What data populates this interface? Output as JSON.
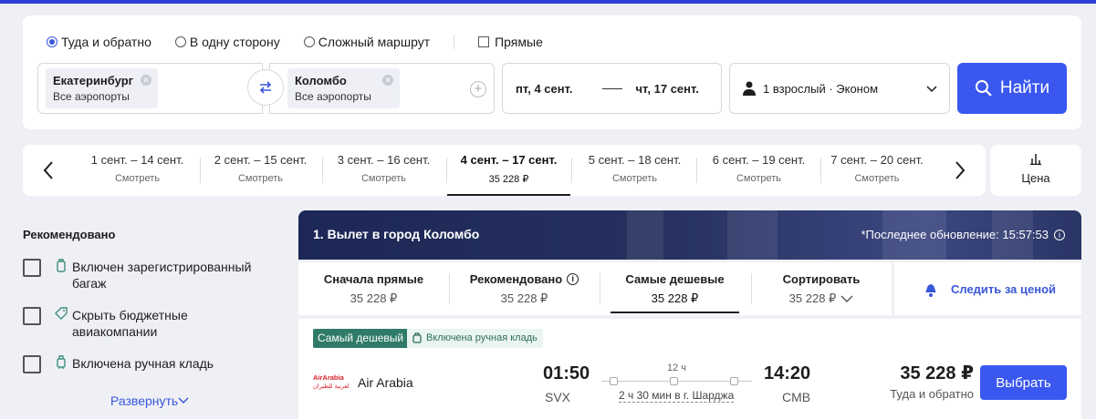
{
  "search": {
    "trip_types": [
      {
        "label": "Туда и обратно",
        "selected": true
      },
      {
        "label": "В одну сторону",
        "selected": false
      },
      {
        "label": "Сложный маршрут",
        "selected": false
      }
    ],
    "direct_label": "Прямые",
    "from": {
      "city": "Екатеринбург",
      "airports": "Все аэропорты"
    },
    "to": {
      "city": "Коломбо",
      "airports": "Все аэропорты"
    },
    "date_from": "пт, 4 сент.",
    "date_to": "чт, 17 сент.",
    "passengers": "1 взрослый · Эконом",
    "find_label": "Найти",
    "accent_color": "#3a57f0"
  },
  "date_strip": {
    "items": [
      {
        "range": "1 сент. – 14 сент.",
        "sub": "Смотреть",
        "selected": false
      },
      {
        "range": "2 сент. – 15 сент.",
        "sub": "Смотреть",
        "selected": false
      },
      {
        "range": "3 сент. – 16 сент.",
        "sub": "Смотреть",
        "selected": false
      },
      {
        "range": "4 сент. – 17 сент.",
        "sub": "35 228 ₽",
        "selected": true
      },
      {
        "range": "5 сент. – 18 сент.",
        "sub": "Смотреть",
        "selected": false
      },
      {
        "range": "6 сент. – 19 сент.",
        "sub": "Смотреть",
        "selected": false
      },
      {
        "range": "7 сент. – 20 сент.",
        "sub": "Смотреть",
        "selected": false
      }
    ],
    "price_sort_label": "Цена"
  },
  "filters": {
    "title": "Рекомендовано",
    "items": [
      {
        "label": "Включен зарегистрированный багаж",
        "icon": "suitcase-icon"
      },
      {
        "label": "Скрыть бюджетные авиакомпании",
        "icon": "tag-icon"
      },
      {
        "label": "Включена ручная кладь",
        "icon": "carry-on-icon"
      }
    ],
    "expand_label": "Развернуть"
  },
  "results": {
    "header_title": "1. Вылет в город Коломбо",
    "last_update": "*Последнее обновление: 15:57:53",
    "sort_tabs": [
      {
        "title": "Сначала прямые",
        "price": "35 228 ₽",
        "selected": false
      },
      {
        "title": "Рекомендовано",
        "price": "35 228 ₽",
        "selected": false
      },
      {
        "title": "Самые дешевые",
        "price": "35 228 ₽",
        "selected": true
      },
      {
        "title": "Сортировать",
        "price": "35 228 ₽",
        "selected": false
      }
    ],
    "track_price_label": "Следить за ценой"
  },
  "flight": {
    "badge_cheapest": "Самый дешевый",
    "badge_carry_on": "Включена ручная кладь",
    "airline": "Air Arabia",
    "logo_text": "AirArabia",
    "logo_text_ar": "العربية للطيران",
    "dep_time": "01:50",
    "dep_code": "SVX",
    "arr_time": "14:20",
    "arr_code": "CMB",
    "duration": "12 ч",
    "stop": "2 ч 30 мин в г. Шарджа",
    "price": "35 228 ₽",
    "price_note": "Туда и обратно",
    "choose_label": "Выбрать"
  }
}
